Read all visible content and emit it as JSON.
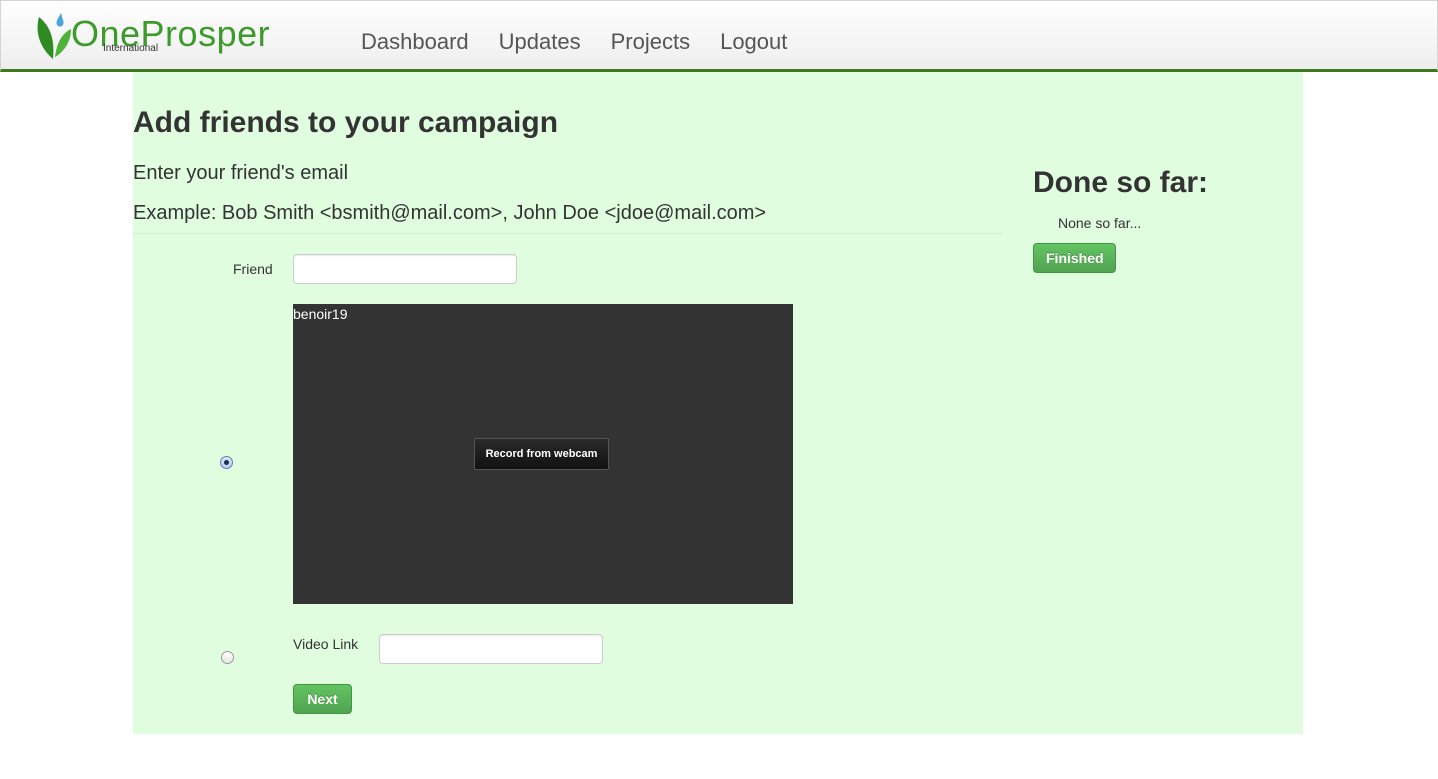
{
  "brand": {
    "name": "OneProsper",
    "sub": "International"
  },
  "nav": {
    "items": [
      "Dashboard",
      "Updates",
      "Projects",
      "Logout"
    ]
  },
  "main": {
    "title": "Add friends to your campaign",
    "instruction": "Enter your friend's email",
    "example": "Example: Bob Smith <bsmith@mail.com>, John Doe <jdoe@mail.com>",
    "friend_label": "Friend",
    "friend_value": "",
    "webcam": {
      "username": "benoir19",
      "record_label": "Record from webcam",
      "selected": true
    },
    "video_link_label": "Video Link",
    "video_link_value": "",
    "next_label": "Next"
  },
  "sidebar": {
    "title": "Done so far:",
    "empty_text": "None so far...",
    "finished_label": "Finished"
  },
  "colors": {
    "content_bg": "#e0fde0",
    "brand_green": "#3d9b2c",
    "nav_border": "#3f7a1e",
    "success": "#5bb75b",
    "webcam_bg": "#333333"
  }
}
